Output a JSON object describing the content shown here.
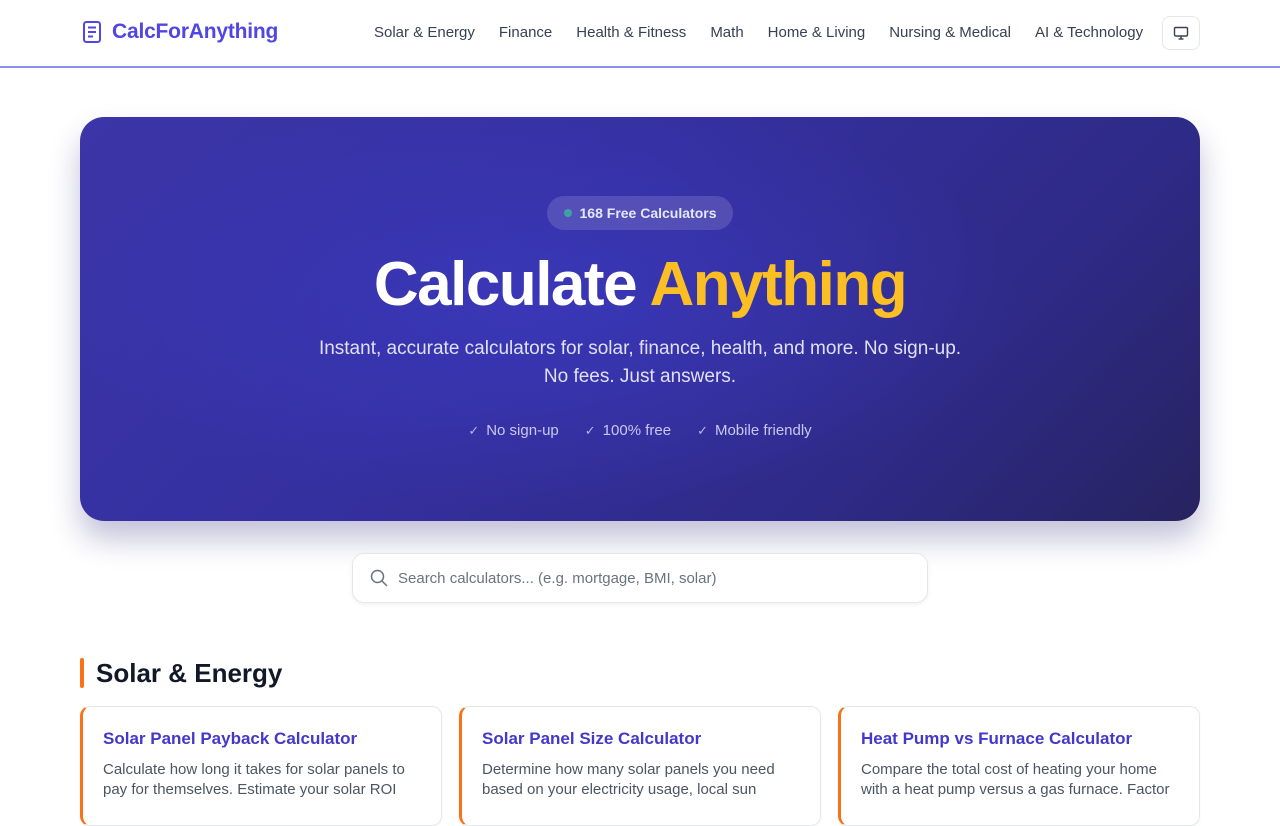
{
  "header": {
    "brand": "CalcForAnything",
    "nav": [
      "Solar & Energy",
      "Finance",
      "Health & Fitness",
      "Math",
      "Home & Living",
      "Nursing & Medical",
      "AI & Technology"
    ],
    "theme_icon": "monitor-icon"
  },
  "hero": {
    "badge": "168 Free Calculators",
    "title_main": "Calculate",
    "title_accent": "Anything",
    "subtitle_line1": "Instant, accurate calculators for solar, finance, health, and more. No sign-up.",
    "subtitle_line2": "No fees. Just answers.",
    "checks": [
      "No sign-up",
      "100% free",
      "Mobile friendly"
    ]
  },
  "search": {
    "placeholder": "Search calculators... (e.g. mortgage, BMI, solar)"
  },
  "section": {
    "title": "Solar & Energy",
    "cards": [
      {
        "title": "Solar Panel Payback Calculator",
        "desc": "Calculate how long it takes for solar panels to pay for themselves. Estimate your solar ROI"
      },
      {
        "title": "Solar Panel Size Calculator",
        "desc": "Determine how many solar panels you need based on your electricity usage, local sun"
      },
      {
        "title": "Heat Pump vs Furnace Calculator",
        "desc": "Compare the total cost of heating your home with a heat pump versus a gas furnace. Factor"
      }
    ]
  },
  "colors": {
    "brand": "#4f46e5",
    "accent_yellow": "#fbbf24",
    "section_accent": "#f97316",
    "hero_bg": "#3530a0"
  }
}
